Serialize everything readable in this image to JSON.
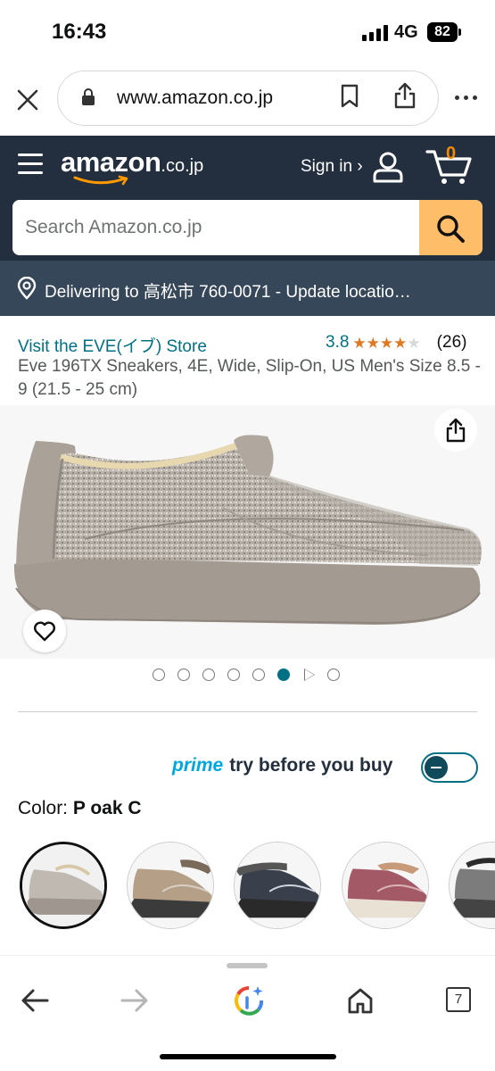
{
  "status_bar": {
    "time": "16:43",
    "network": "4G",
    "battery": "82"
  },
  "browser": {
    "url": "www.amazon.co.jp",
    "tab_count": "7"
  },
  "header": {
    "logo_text": "amazon",
    "logo_tld": ".co.jp",
    "signin_label": "Sign in ›",
    "cart_count": "0",
    "search_placeholder": "Search Amazon.co.jp",
    "delivery_text": "Delivering to 高松市 760-0071 - Update locatio…"
  },
  "product": {
    "store_link": "Visit the EVE(イブ) Store",
    "rating_value": "3.8",
    "rating_stars": 3.8,
    "rating_count": "(26)",
    "title": "Eve 196TX Sneakers, 4E, Wide, Slip-On, US Men's Size 8.5 - 9 (21.5 - 25 cm)",
    "image_count": 8,
    "active_image_index": 5,
    "video_index": 6
  },
  "prime": {
    "brand": "prime",
    "text": "try before you buy",
    "toggle_on": false
  },
  "color": {
    "label": "Color:",
    "selected": "P oak C",
    "swatches": [
      "P oak C",
      "beige",
      "dark gray",
      "navy",
      "pink",
      "gray"
    ]
  },
  "colors": {
    "header_bg": "#232f3e",
    "delivery_bg": "#37475a",
    "search_button": "#febd69",
    "link": "#007185",
    "star": "#de7921"
  },
  "icons": [
    "close-icon",
    "lock-icon",
    "bookmark-icon",
    "share-icon",
    "more-icon",
    "menu-icon",
    "user-icon",
    "cart-icon",
    "search-icon",
    "location-pin-icon",
    "heart-icon",
    "back-icon",
    "forward-icon",
    "google-lens-icon",
    "home-icon",
    "tabs-icon"
  ]
}
